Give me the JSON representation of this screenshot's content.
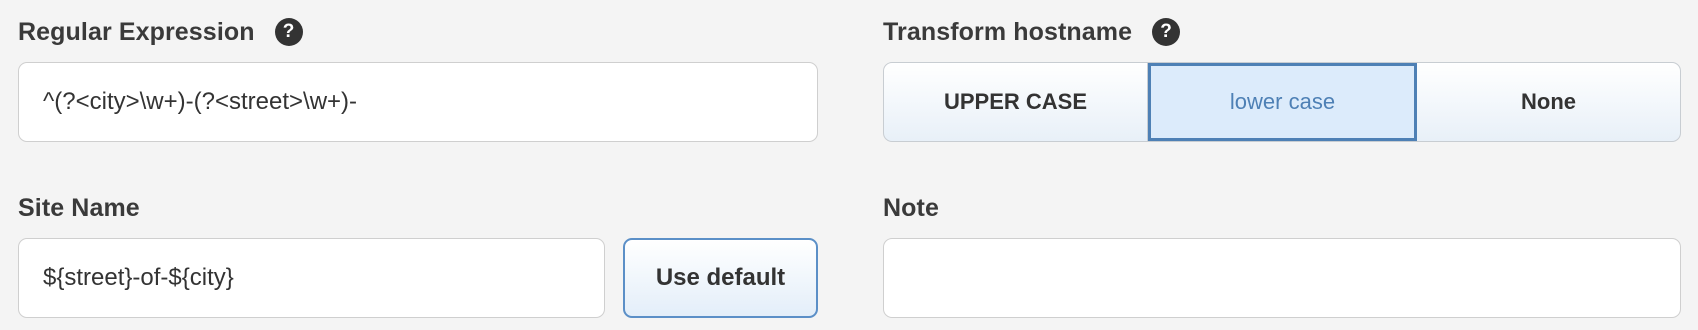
{
  "regex": {
    "label": "Regular Expression",
    "help_icon": "question-icon",
    "value": "^(?<city>\\w+)-(?<street>\\w+)-"
  },
  "transform": {
    "label": "Transform hostname",
    "help_icon": "question-icon",
    "options": [
      "UPPER CASE",
      "lower case",
      "None"
    ],
    "selected": "lower case"
  },
  "site_name": {
    "label": "Site Name",
    "value": "${street}-of-${city}",
    "button_label": "Use default"
  },
  "note": {
    "label": "Note",
    "value": ""
  },
  "colors": {
    "accent": "#4e80b5",
    "background": "#f4f4f4"
  }
}
